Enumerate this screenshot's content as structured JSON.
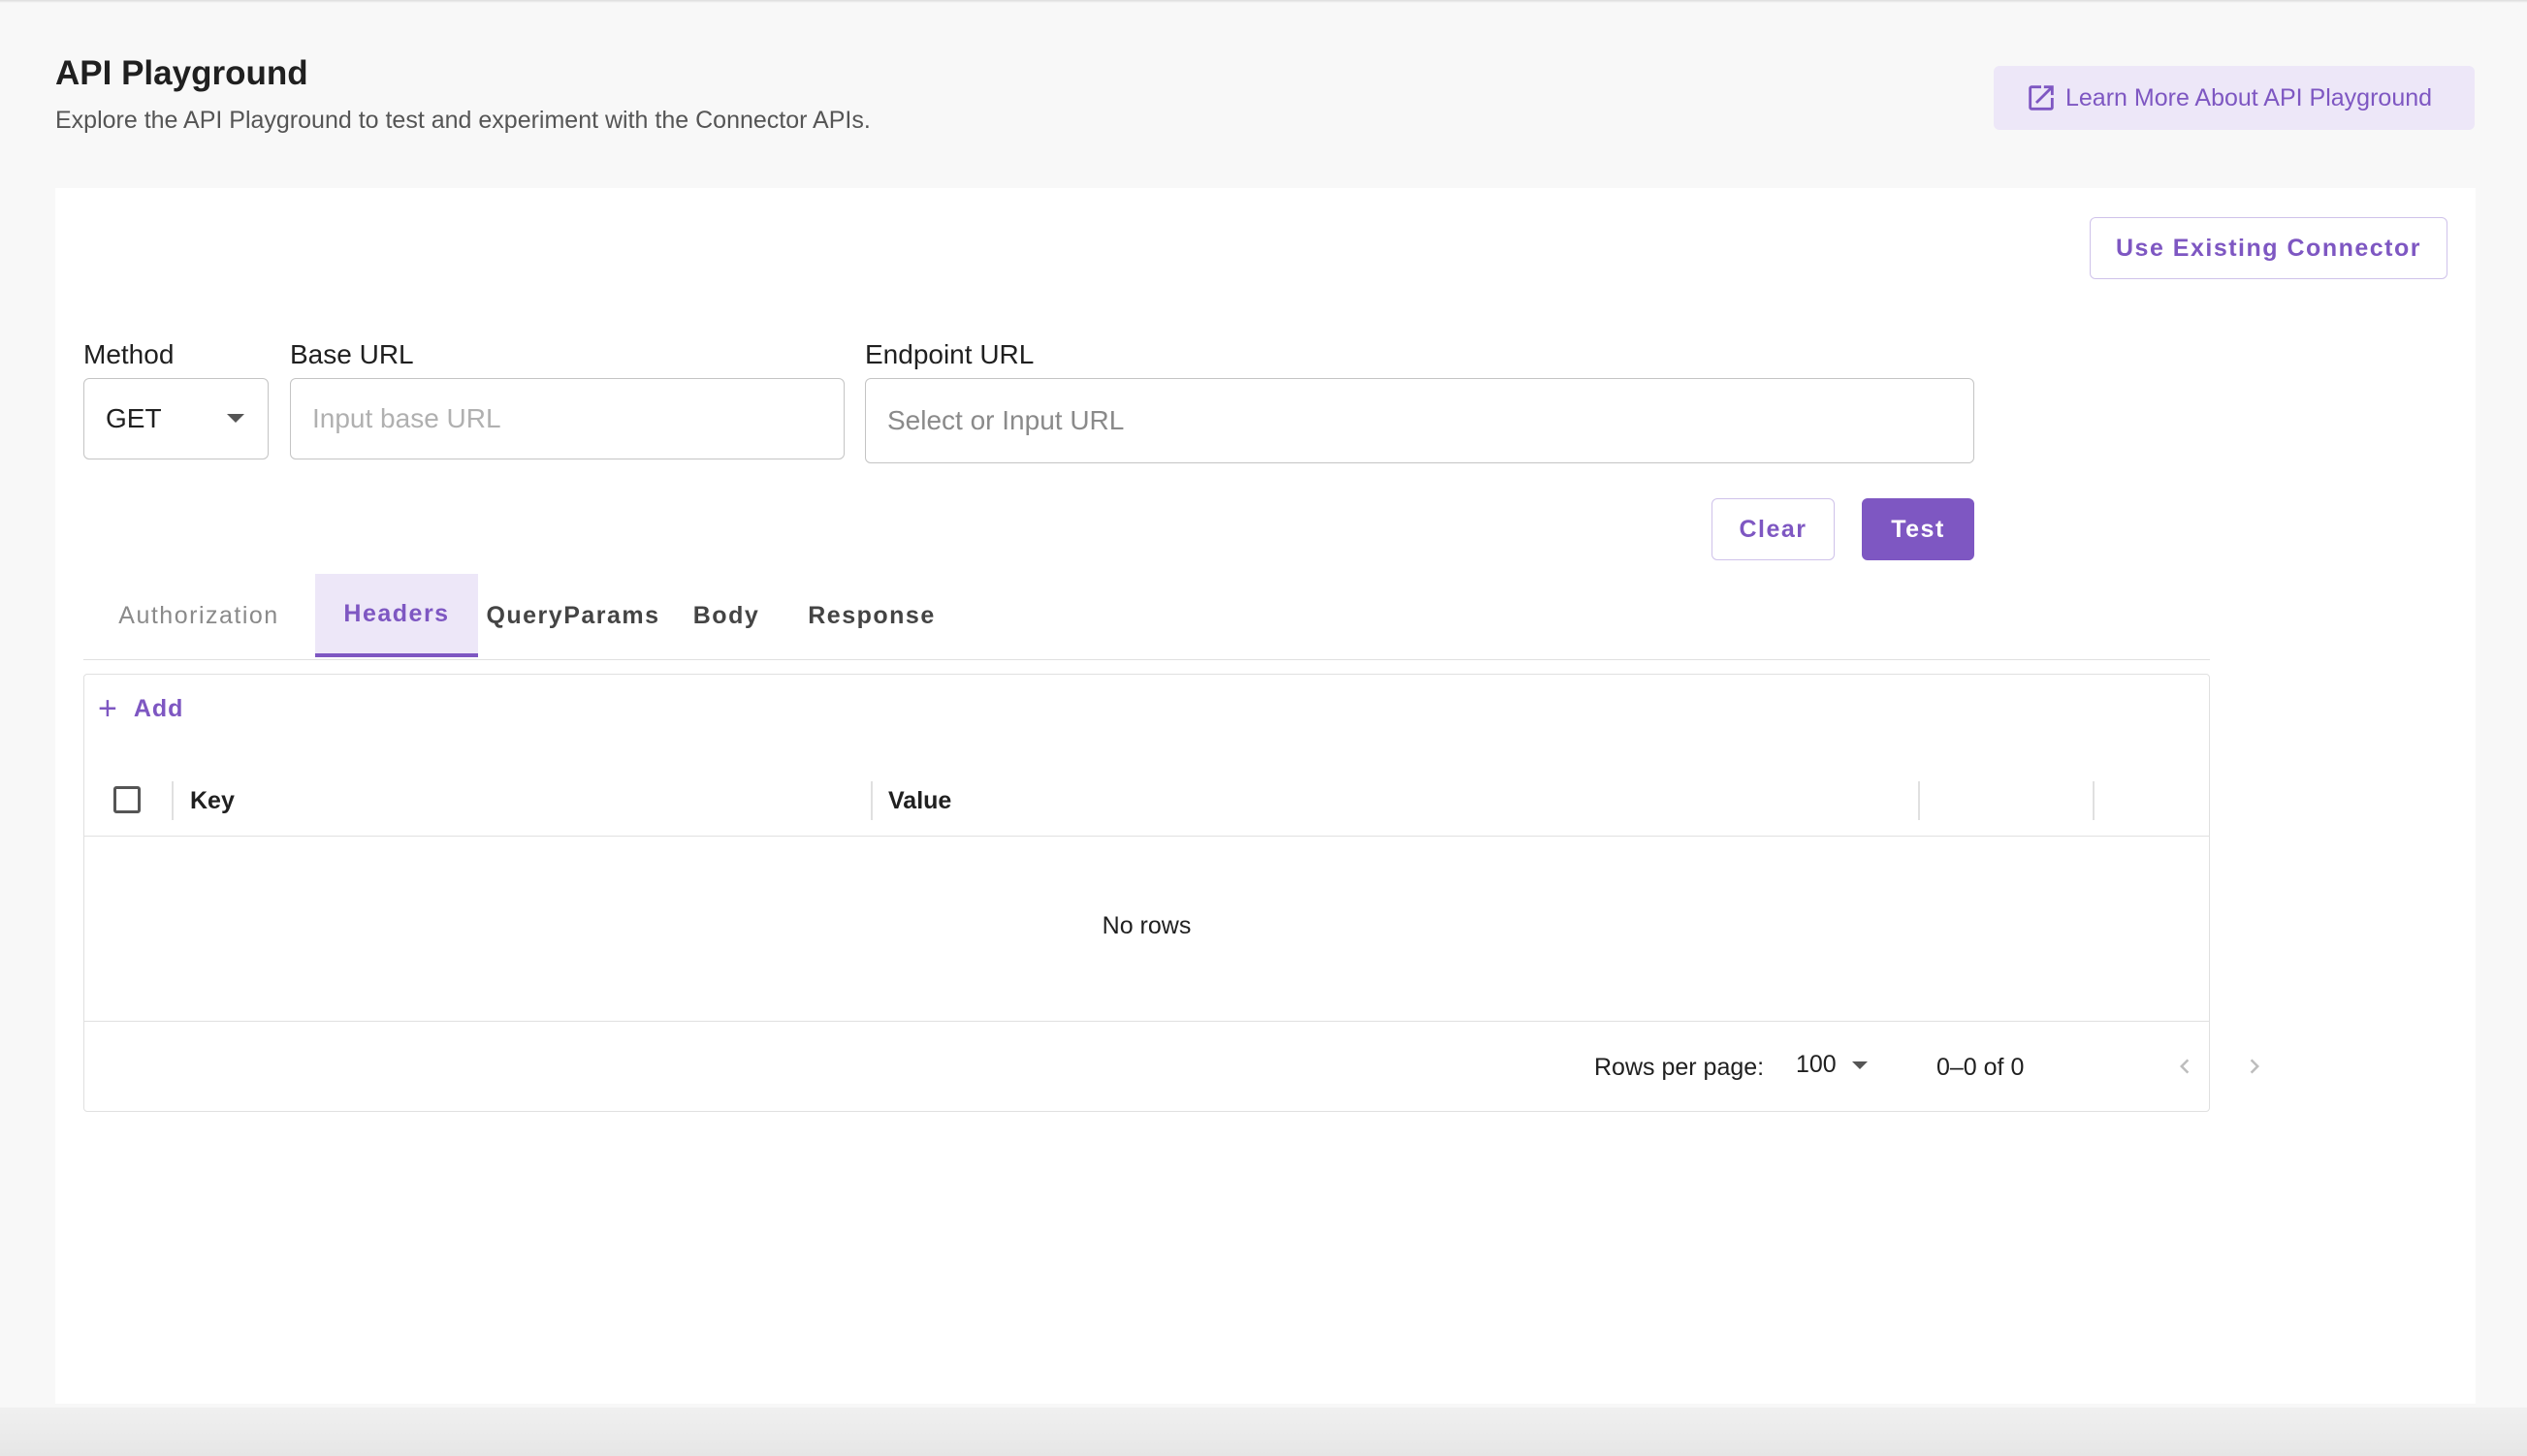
{
  "header": {
    "title": "API Playground",
    "subtitle": "Explore the API Playground to test and experiment with the Connector APIs.",
    "learn_more_label": "Learn More About API Playground",
    "learn_more_icon": "open-in-new-icon"
  },
  "toolbar": {
    "use_existing_label": "Use Existing Connector"
  },
  "form": {
    "method_label": "Method",
    "method_value": "GET",
    "base_url_label": "Base URL",
    "base_url_placeholder": "Input base URL",
    "endpoint_url_label": "Endpoint URL",
    "endpoint_url_placeholder": "Select or Input URL",
    "clear_label": "Clear",
    "test_label": "Test"
  },
  "tabs": [
    {
      "label": "Authorization",
      "state": "disabled"
    },
    {
      "label": "Headers",
      "state": "active"
    },
    {
      "label": "QueryParams",
      "state": "normal"
    },
    {
      "label": "Body",
      "state": "normal"
    },
    {
      "label": "Response",
      "state": "normal"
    }
  ],
  "grid": {
    "add_label": "Add",
    "columns": [
      "Key",
      "Value"
    ],
    "empty_text": "No rows",
    "rows_per_page_label": "Rows per page:",
    "rows_per_page_value": "100",
    "range_text": "0–0 of 0"
  },
  "colors": {
    "accent": "#7e57c2",
    "accent_light": "#ede7f8"
  }
}
